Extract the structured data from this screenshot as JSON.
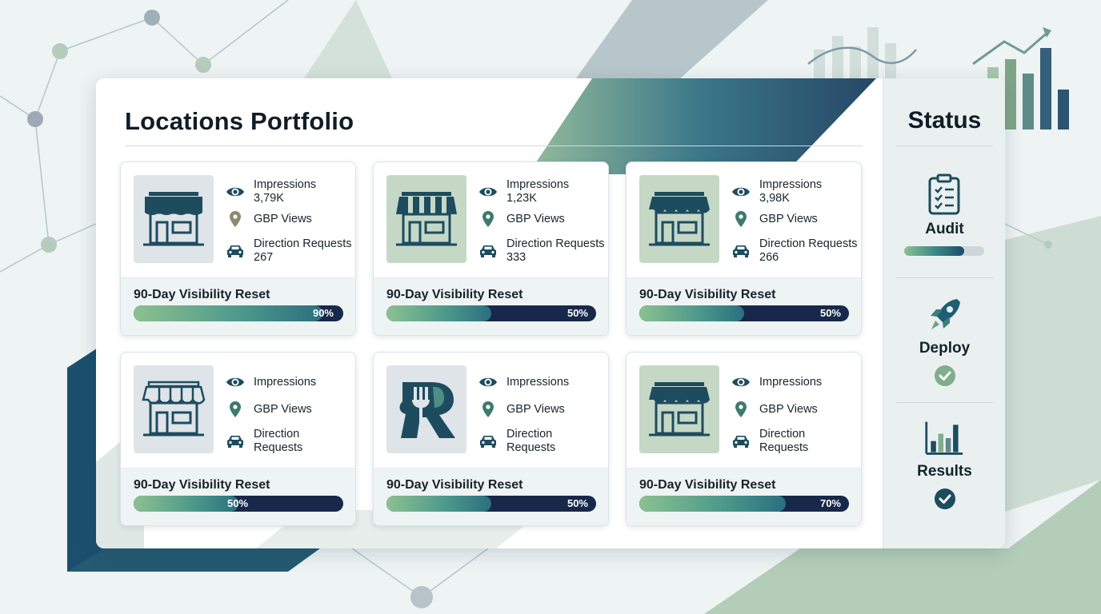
{
  "page": {
    "title": "Locations Portfolio"
  },
  "cards": [
    {
      "thumb": "storefront-icon",
      "thumb_style": "grey",
      "impressions": {
        "label": "Impressions",
        "value": "3,79K"
      },
      "gbp": {
        "label": "GBP Views"
      },
      "directions": {
        "label": "Direction Requests",
        "value": "267"
      },
      "footer": {
        "label": "90-Day Visibility Reset",
        "progress": 0.9,
        "progress_text": "90%"
      }
    },
    {
      "thumb": "striped-awning-store-icon",
      "thumb_style": "green",
      "impressions": {
        "label": "Impressions",
        "value": "1,23K"
      },
      "gbp": {
        "label": "GBP Views"
      },
      "directions": {
        "label": "Direction Requests",
        "value": "333"
      },
      "footer": {
        "label": "90-Day Visibility Reset",
        "progress": 0.5,
        "progress_text": "50%"
      }
    },
    {
      "thumb": "scalloped-awning-store-icon",
      "thumb_style": "green",
      "impressions": {
        "label": "Impressions",
        "value": "3,98K"
      },
      "gbp": {
        "label": "GBP Views"
      },
      "directions": {
        "label": "Direction Requests",
        "value": "266"
      },
      "footer": {
        "label": "90-Day Visibility Reset",
        "progress": 0.5,
        "progress_text": "50%"
      }
    },
    {
      "thumb": "outline-store-icon",
      "thumb_style": "grey",
      "impressions": {
        "label": "Impressions"
      },
      "gbp": {
        "label": "GBP Views"
      },
      "directions": {
        "label": "Direction Requests",
        "label_lines": [
          "Direction",
          "Requests"
        ]
      },
      "footer": {
        "label": "90-Day Visibility Reset",
        "progress": 0.5,
        "progress_text": "50%"
      }
    },
    {
      "thumb": "restaurant-fork-logo-icon",
      "thumb_style": "grey",
      "impressions": {
        "label": "Impressions"
      },
      "gbp": {
        "label": "GBP Views"
      },
      "directions": {
        "label": "Direction Requests",
        "label_lines": [
          "Direction",
          "Requests"
        ]
      },
      "footer": {
        "label": "90-Day Visibility Reset",
        "progress": 0.5,
        "progress_text": "50%"
      }
    },
    {
      "thumb": "scalloped-awning-store-icon",
      "thumb_style": "green",
      "impressions": {
        "label": "Impressions"
      },
      "gbp": {
        "label": "GBP Views"
      },
      "directions": {
        "label": "Direction Requests",
        "label_lines": [
          "Direction",
          "Requests"
        ]
      },
      "footer": {
        "label": "90-Day Visibility Reset",
        "progress": 0.7,
        "progress_text": "70%"
      }
    }
  ],
  "status": {
    "title": "Status",
    "steps": [
      {
        "label": "Audit",
        "icon": "clipboard-checklist-icon",
        "progress": 0.75
      },
      {
        "label": "Deploy",
        "icon": "rocket-icon",
        "done": true
      },
      {
        "label": "Results",
        "icon": "bar-chart-icon",
        "done": true
      }
    ]
  },
  "colors": {
    "navy": "#17284a",
    "teal": "#1c5a76",
    "green": "#8cc190",
    "sage": "#5e8b73",
    "icon": "#1d4c5f"
  }
}
